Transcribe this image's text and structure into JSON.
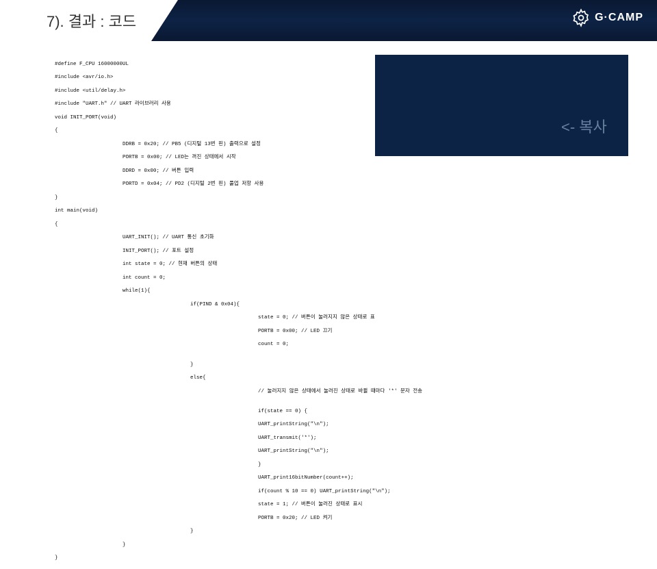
{
  "header": {
    "title": "7). 결과 : 코드",
    "logo_text": "G·CAMP"
  },
  "highlight": {
    "copy_label": "<- 복사"
  },
  "code": {
    "l01": "#define F_CPU 16000000UL",
    "l02": "#include <avr/io.h>",
    "l03": "#include <util/delay.h>",
    "l04": "#include \"UART.h\" // UART 라이브러리 사용",
    "l05": "void INIT_PORT(void)",
    "l06": "{",
    "l07": "                      DDRB = 0x20; // PB5 (디지털 13번 핀) 출력으로 설정",
    "l08": "                      PORTB = 0x00; // LED는 꺼진 상태에서 시작",
    "l09": "                      DDRD = 0x00; // 버튼 입력",
    "l10": "                      PORTD = 0x04; // PD2 (디지털 2번 핀) 풀업 저항 사용",
    "l11": "}",
    "l12": "int main(void)",
    "l13": "{",
    "l14": "                      UART_INIT(); // UART 통신 초기화",
    "l15": "                      INIT_PORT(); // 포트 설정",
    "l16": "                      int state = 0; // 현재 버튼의 상태",
    "l17": "                      int count = 0;",
    "l18": "                      while(1){",
    "l19": "                                            if(PIND & 0x04){",
    "l20": "                                                                  state = 0; // 버튼이 눌러지지 않은 상태로 표",
    "l21": "                                                                  PORTB = 0x00; // LED 끄기",
    "l22": "                                                                  count = 0;",
    "l23": "",
    "l24": "                                            }",
    "l25": "                                            else{",
    "l26": "                                                                  // 눌러지지 않은 상태에서 눌러진 상태로 바뀔 때마다 '*' 문자 전송",
    "l27": "",
    "l28": "                                                                  if(state == 0) {",
    "l29": "                                                                  UART_printString(\"\\n\");",
    "l30": "                                                                  UART_transmit('*');",
    "l31": "                                                                  UART_printString(\"\\n\");",
    "l32": "                                                                  }",
    "l33": "                                                                  UART_print16bitNumber(count++);",
    "l34": "                                                                  if(count % 10 == 0) UART_printString(\"\\n\");",
    "l35": "                                                                  state = 1; // 버튼이 눌러진 상태로 표시",
    "l36": "                                                                  PORTB = 0x20; // LED 켜기",
    "l37": "                                            }",
    "l38": "                      }",
    "l39": "}"
  }
}
